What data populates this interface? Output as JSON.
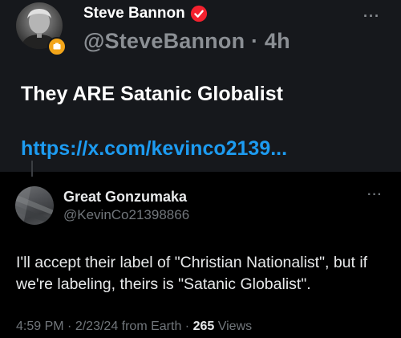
{
  "original_post": {
    "display_name": "Steve Bannon",
    "handle": "@SteveBannon",
    "separator": "·",
    "time": "4h",
    "text": "They ARE Satanic Globalist",
    "link": "https://x.com/kevinco2139...",
    "more_label": "···"
  },
  "reply_post": {
    "display_name": "Great Gonzumaka",
    "handle": "@KevinCo21398866",
    "more_label": "···",
    "text": "I'll accept their label of \"Christian Nationalist\", but if we're labeling, theirs is \"Satanic Globalist\".",
    "time": "4:59 PM",
    "date": "2/23/24 from Earth",
    "dot": "·",
    "views_count": "265",
    "views_label": "Views"
  },
  "colors": {
    "link": "#1d9bf0",
    "verified": "#f4212e",
    "affiliate_badge": "#f2a51a",
    "muted": "#71767b"
  }
}
